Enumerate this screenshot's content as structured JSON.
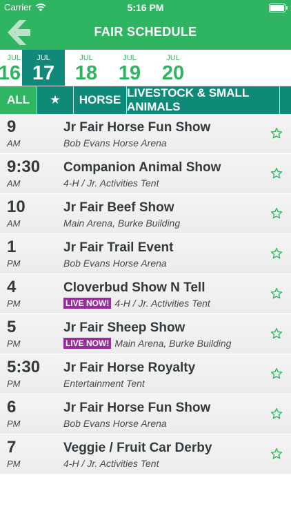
{
  "status": {
    "carrier": "Carrier",
    "time": "5:16 PM"
  },
  "nav": {
    "title": "FAIR SCHEDULE"
  },
  "dates": [
    {
      "month": "JUL",
      "day": "16",
      "selected": false
    },
    {
      "month": "JUL",
      "day": "17",
      "selected": true
    },
    {
      "month": "JUL",
      "day": "18",
      "selected": false
    },
    {
      "month": "JUL",
      "day": "19",
      "selected": false
    },
    {
      "month": "JUL",
      "day": "20",
      "selected": false
    }
  ],
  "filters": [
    "ALL",
    "★",
    "HORSE",
    "LIVESTOCK & SMALL ANIMALS"
  ],
  "events": [
    {
      "time": "9",
      "ampm": "AM",
      "title": "Jr Fair Horse Fun Show",
      "location": "Bob Evans Horse Arena",
      "live": false
    },
    {
      "time": "9:30",
      "ampm": "AM",
      "title": "Companion Animal Show",
      "location": "4-H / Jr. Activities Tent",
      "live": false
    },
    {
      "time": "10",
      "ampm": "AM",
      "title": "Jr Fair Beef Show",
      "location": "Main Arena, Burke Building",
      "live": false
    },
    {
      "time": "1",
      "ampm": "PM",
      "title": "Jr Fair Trail Event",
      "location": "Bob Evans Horse Arena",
      "live": false
    },
    {
      "time": "4",
      "ampm": "PM",
      "title": "Cloverbud Show N Tell",
      "location": "4-H / Jr. Activities Tent",
      "live": true
    },
    {
      "time": "5",
      "ampm": "PM",
      "title": "Jr Fair Sheep Show",
      "location": "Main Arena, Burke Building",
      "live": true
    },
    {
      "time": "5:30",
      "ampm": "PM",
      "title": "Jr Fair Horse Royalty",
      "location": "Entertainment Tent",
      "live": false
    },
    {
      "time": "6",
      "ampm": "PM",
      "title": "Jr  Fair Horse Fun Show",
      "location": "Bob Evans Horse Arena",
      "live": false
    },
    {
      "time": "7",
      "ampm": "PM",
      "title": "Veggie / Fruit Car Derby",
      "location": "4-H / Jr. Activities Tent",
      "live": false
    }
  ],
  "live_label": "LIVE NOW!",
  "colors": {
    "brand_green": "#2fb562",
    "teal": "#0f8a78",
    "live_purple": "#9b2c9e"
  }
}
